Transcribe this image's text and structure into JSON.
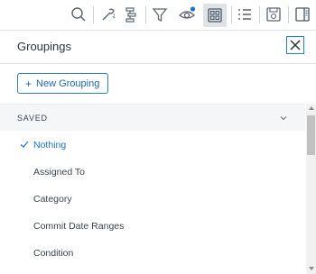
{
  "toolbar": {
    "icons": [
      "search-icon",
      "wand-icon",
      "hierarchy-icon",
      "filter-icon",
      "view-icon",
      "grid-icon",
      "list-icon",
      "export-icon",
      "panel-icon"
    ],
    "active_icon": "grid-icon",
    "notify_dot_color": "#1e6fd0"
  },
  "panel": {
    "title": "Groupings",
    "close_icon": "close-icon"
  },
  "new_button": {
    "plus": "+",
    "label": "New Grouping"
  },
  "saved_section": {
    "label": "SAVED",
    "chevron": "chevron-down-icon"
  },
  "groupings": [
    {
      "label": "Nothing",
      "selected": true
    },
    {
      "label": "Assigned To",
      "selected": false
    },
    {
      "label": "Category",
      "selected": false
    },
    {
      "label": "Commit Date Ranges",
      "selected": false
    },
    {
      "label": "Condition",
      "selected": false
    }
  ],
  "colors": {
    "accent": "#1f73c0",
    "text": "#3b4450",
    "border": "#e3e5e8"
  }
}
